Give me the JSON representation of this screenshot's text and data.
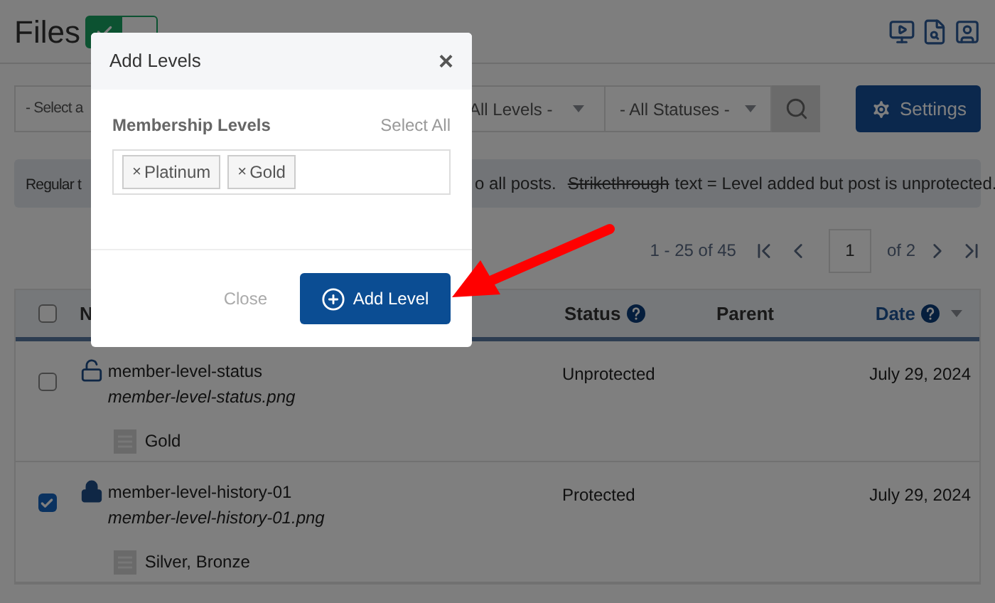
{
  "header": {
    "title": "Files",
    "toggle": {
      "on": true
    }
  },
  "filters": {
    "select_1": "- Select a",
    "levels": "All Levels -",
    "statuses": "- All Statuses -"
  },
  "settings_button": "Settings",
  "info_bar": {
    "text_1": "Regular t",
    "text_2": "o all posts.",
    "strikethrough": "Strikethrough",
    "text_3": "text = Level added but post is unprotected."
  },
  "pagination": {
    "range": "1 - 25 of 45",
    "page": "1",
    "of": "of 2"
  },
  "table": {
    "header_checked": false,
    "columns": [
      {
        "label": "N",
        "help": false,
        "sorted": false
      },
      {
        "label": "Status",
        "help": true,
        "sorted": false
      },
      {
        "label": "Parent",
        "help": false,
        "sorted": false
      },
      {
        "label": "Date",
        "help": true,
        "sorted": true
      }
    ],
    "rows": [
      {
        "checked": false,
        "locked": false,
        "title": "member-level-status",
        "file": "member-level-status.png",
        "levels": "Gold",
        "status": "Unprotected",
        "date": "July 29, 2024"
      },
      {
        "checked": true,
        "locked": true,
        "title": "member-level-history-01",
        "file": "member-level-history-01.png",
        "levels": "Silver, Bronze",
        "status": "Protected",
        "date": "July 29, 2024"
      }
    ]
  },
  "dialog": {
    "title": "Add Levels",
    "close": "×",
    "field_label": "Membership Levels",
    "select_all": "Select All",
    "tags": [
      {
        "remove": "×",
        "label": "Platinum"
      },
      {
        "remove": "×",
        "label": "Gold"
      }
    ],
    "close_button": "Close",
    "add_button": "Add Level"
  }
}
